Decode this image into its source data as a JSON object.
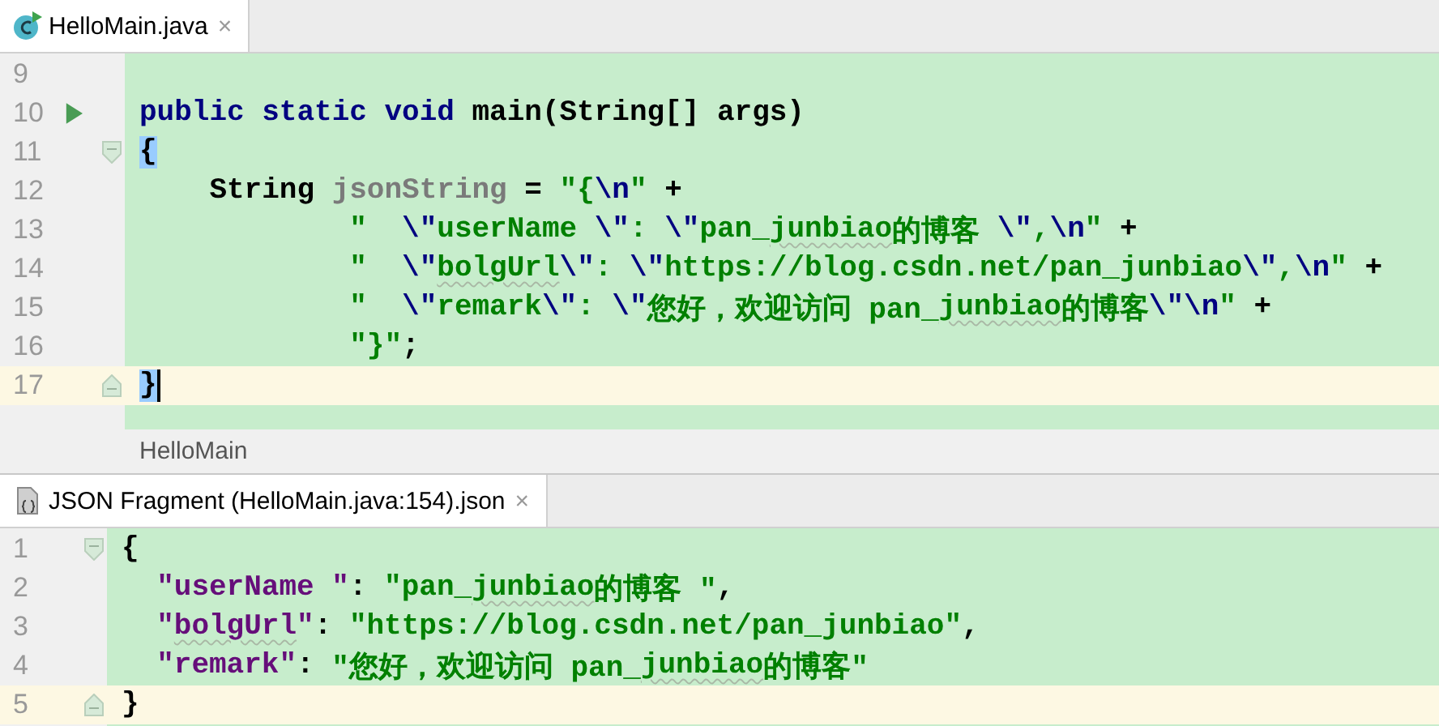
{
  "editor_tab": {
    "label": "HelloMain.java",
    "close": "×",
    "selected": true
  },
  "editor": {
    "lines": [
      {
        "number": "9",
        "current": false,
        "caret": false
      },
      {
        "number": "10",
        "current": false,
        "caret": false,
        "kind": "run",
        "tokens": [
          {
            "kind": "kw",
            "text": "public static void "
          },
          {
            "kind": "p",
            "text": "main(String[] args)"
          }
        ]
      },
      {
        "number": "11",
        "current": false,
        "caret": false,
        "kind": "fold_start",
        "tokens": [
          {
            "kind": "p",
            "text": "{",
            "match": true
          }
        ]
      },
      {
        "number": "12",
        "current": false,
        "caret": false,
        "tokens": [
          {
            "kind": "p",
            "text": "    String "
          },
          {
            "kind": "var",
            "text": "jsonString"
          },
          {
            "kind": "p",
            "text": " = "
          },
          {
            "kind": "s",
            "text": "\"{"
          },
          {
            "kind": "e",
            "text": "\\n"
          },
          {
            "kind": "s",
            "text": "\""
          },
          {
            "kind": "p",
            "text": " +"
          }
        ]
      },
      {
        "number": "13",
        "current": false,
        "caret": false,
        "tokens": [
          {
            "kind": "s",
            "text": "            \"  "
          },
          {
            "kind": "e",
            "text": "\\\""
          },
          {
            "kind": "s",
            "text": "userName "
          },
          {
            "kind": "e",
            "text": "\\\""
          },
          {
            "kind": "s",
            "text": ": "
          },
          {
            "kind": "e",
            "text": "\\\""
          },
          {
            "kind": "s",
            "text": "pan_"
          },
          {
            "kind": "s",
            "text": "junbiao",
            "typo": true
          },
          {
            "kind": "s",
            "text": "的博客 "
          },
          {
            "kind": "e",
            "text": "\\\""
          },
          {
            "kind": "s",
            "text": ","
          },
          {
            "kind": "e",
            "text": "\\n"
          },
          {
            "kind": "s",
            "text": "\""
          },
          {
            "kind": "p",
            "text": " +"
          }
        ]
      },
      {
        "number": "14",
        "current": false,
        "caret": false,
        "tokens": [
          {
            "kind": "s",
            "text": "            \"  "
          },
          {
            "kind": "e",
            "text": "\\\""
          },
          {
            "kind": "s",
            "text": "bolgUrl",
            "typo": true
          },
          {
            "kind": "e",
            "text": "\\\""
          },
          {
            "kind": "s",
            "text": ": "
          },
          {
            "kind": "e",
            "text": "\\\""
          },
          {
            "kind": "s",
            "text": "https://blog.csdn.net/pan_junbiao"
          },
          {
            "kind": "e",
            "text": "\\\""
          },
          {
            "kind": "s",
            "text": ","
          },
          {
            "kind": "e",
            "text": "\\n"
          },
          {
            "kind": "s",
            "text": "\""
          },
          {
            "kind": "p",
            "text": " +"
          }
        ]
      },
      {
        "number": "15",
        "current": false,
        "caret": false,
        "tokens": [
          {
            "kind": "s",
            "text": "            \"  "
          },
          {
            "kind": "e",
            "text": "\\\""
          },
          {
            "kind": "s",
            "text": "remark"
          },
          {
            "kind": "e",
            "text": "\\\""
          },
          {
            "kind": "s",
            "text": ": "
          },
          {
            "kind": "e",
            "text": "\\\""
          },
          {
            "kind": "s",
            "text": "您好，欢迎访问 pan_"
          },
          {
            "kind": "s",
            "text": "junbiao",
            "typo": true
          },
          {
            "kind": "s",
            "text": "的博客"
          },
          {
            "kind": "e",
            "text": "\\\""
          },
          {
            "kind": "e",
            "text": "\\n"
          },
          {
            "kind": "s",
            "text": "\""
          },
          {
            "kind": "p",
            "text": " +"
          }
        ]
      },
      {
        "number": "16",
        "current": false,
        "caret": false,
        "tokens": [
          {
            "kind": "s",
            "text": "            \"}\""
          },
          {
            "kind": "p",
            "text": ";"
          }
        ]
      },
      {
        "number": "17",
        "current": true,
        "caret": true,
        "kind": "fold_end",
        "tokens": [
          {
            "kind": "p",
            "text": "}",
            "match": true
          }
        ]
      }
    ]
  },
  "breadcrumb": "HelloMain",
  "json_tab": {
    "label": "JSON Fragment (HelloMain.java:154).json",
    "close": "×",
    "selected": true
  },
  "json_editor": {
    "lines": [
      {
        "number": "1",
        "current": false,
        "kind": "fold_start",
        "tokens": [
          {
            "kind": "p",
            "text": "{"
          }
        ]
      },
      {
        "number": "2",
        "current": false,
        "tokens": [
          {
            "kind": "key",
            "text": "  \"userName \""
          },
          {
            "kind": "p",
            "text": ": "
          },
          {
            "kind": "s",
            "text": "\"pan_"
          },
          {
            "kind": "s",
            "text": "junbiao",
            "typo": true
          },
          {
            "kind": "s",
            "text": "的博客 \""
          },
          {
            "kind": "p",
            "text": ","
          }
        ]
      },
      {
        "number": "3",
        "current": false,
        "tokens": [
          {
            "kind": "key",
            "text": "  \""
          },
          {
            "kind": "key",
            "text": "bolgUrl",
            "typo": true
          },
          {
            "kind": "key",
            "text": "\""
          },
          {
            "kind": "p",
            "text": ": "
          },
          {
            "kind": "s",
            "text": "\"https://blog.csdn.net/pan_junbiao\""
          },
          {
            "kind": "p",
            "text": ","
          }
        ]
      },
      {
        "number": "4",
        "current": false,
        "tokens": [
          {
            "kind": "key",
            "text": "  \"remark\""
          },
          {
            "kind": "p",
            "text": ": "
          },
          {
            "kind": "s",
            "text": "\"您好，欢迎访问 pan_"
          },
          {
            "kind": "s",
            "text": "junbiao",
            "typo": true
          },
          {
            "kind": "s",
            "text": "的博客\""
          }
        ]
      },
      {
        "number": "5",
        "current": true,
        "kind": "fold_end",
        "tokens": [
          {
            "kind": "p",
            "text": "}"
          }
        ]
      }
    ]
  }
}
